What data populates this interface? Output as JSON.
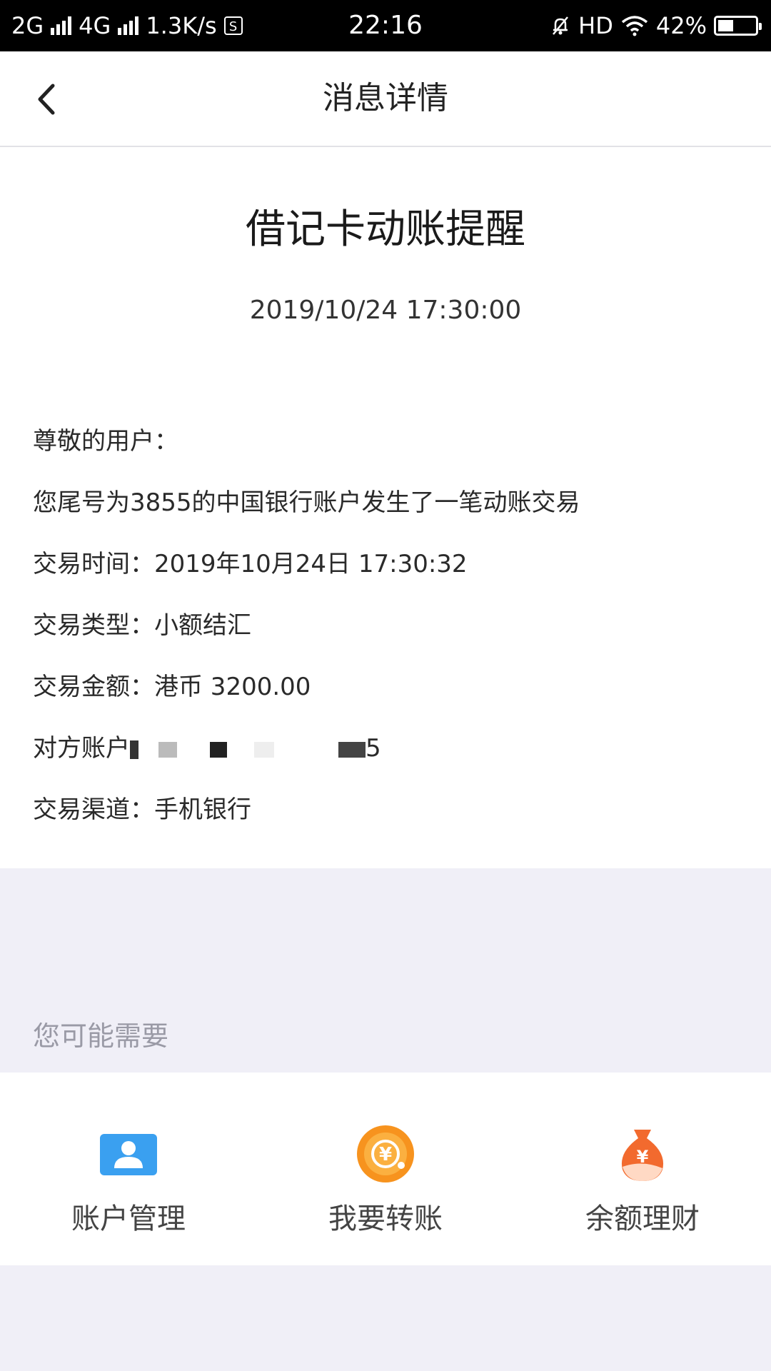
{
  "status_bar": {
    "network1": "2G",
    "network2": "4G",
    "speed": "1.3K/s",
    "time": "22:16",
    "hd": "HD",
    "battery": "42%",
    "battery_level": 0.42
  },
  "nav": {
    "title": "消息详情"
  },
  "message": {
    "title": "借记卡动账提醒",
    "datetime": "2019/10/24   17:30:00",
    "greeting": "尊敬的用户：",
    "intro": "您尾号为3855的中国银行账户发生了一笔动账交易",
    "lines": {
      "time": "交易时间：2019年10月24日 17:30:32",
      "type": "交易类型：小额结汇",
      "amount": "交易金额：港币 3200.00",
      "counterparty_prefix": "对方账户",
      "counterparty_suffix": "5",
      "channel": "交易渠道：手机银行"
    }
  },
  "recommendations": {
    "heading": "您可能需要",
    "items": [
      {
        "label": "账户管理",
        "icon": "account-card-icon",
        "color": "#3aa0f0"
      },
      {
        "label": "我要转账",
        "icon": "yuan-coin-icon",
        "color": "#f7931e"
      },
      {
        "label": "余额理财",
        "icon": "money-bag-icon",
        "color": "#f26a2e"
      }
    ]
  }
}
